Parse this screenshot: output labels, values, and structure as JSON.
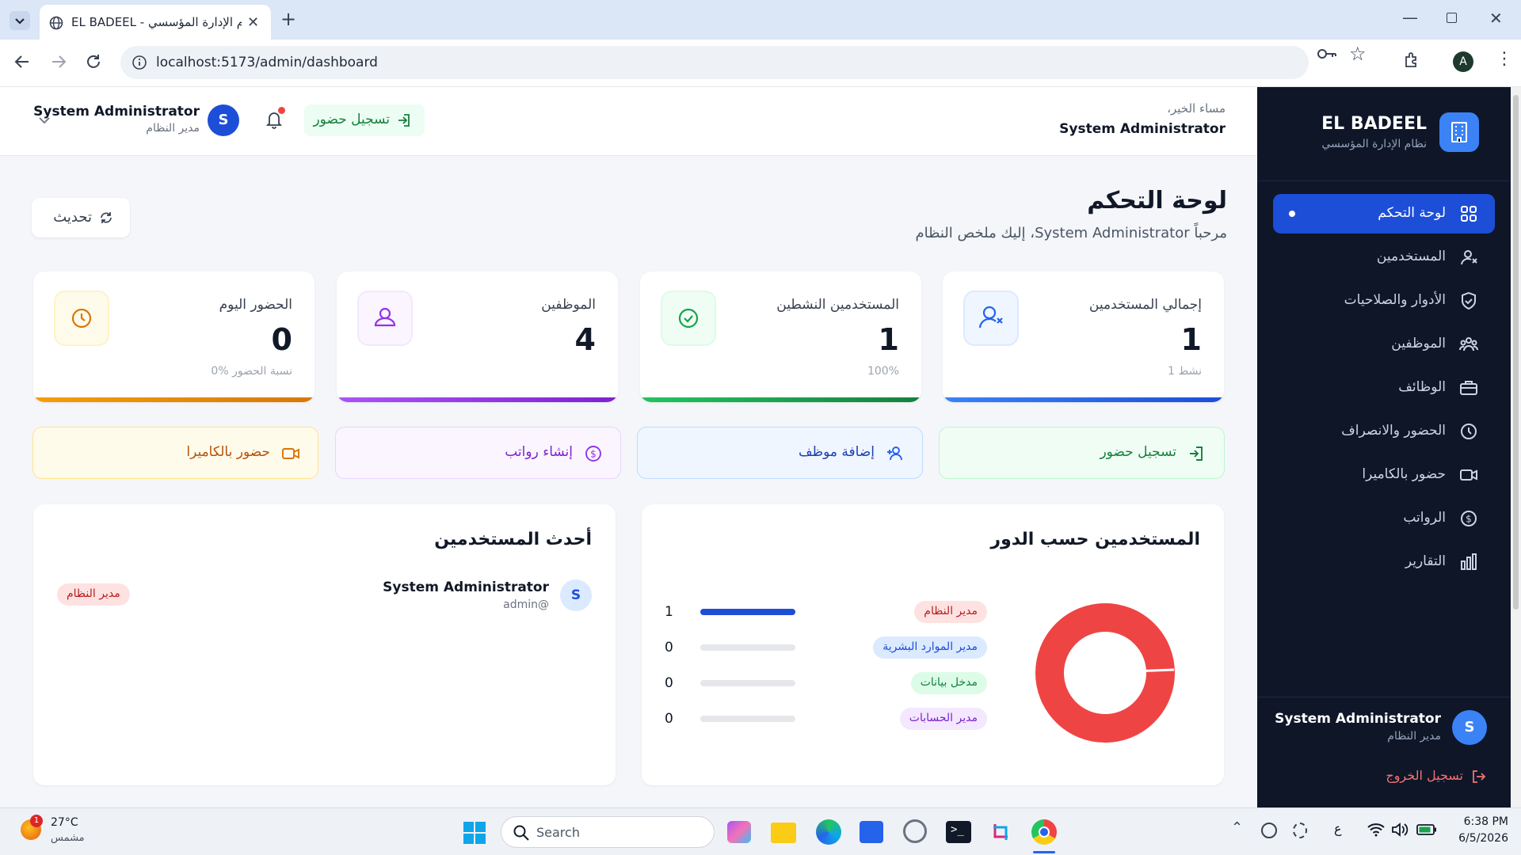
{
  "browser": {
    "tab_title": "EL BADEEL - نظام الإدارة المؤسسي",
    "url": "localhost:5173/admin/dashboard",
    "profile_initial": "A"
  },
  "header": {
    "greeting": "مساء الخير،",
    "user_name": "System Administrator",
    "checkin_label": "تسجيل حضور",
    "profile_name": "System Administrator",
    "profile_role": "مدير النظام",
    "avatar_initial": "S"
  },
  "sidebar": {
    "brand": "EL BADEEL",
    "subtitle": "نظام الإدارة المؤسسي",
    "items": [
      {
        "label": "لوحة التحكم",
        "icon": "grid-icon",
        "active": true
      },
      {
        "label": "المستخدمين",
        "icon": "users-icon"
      },
      {
        "label": "الأدوار والصلاحيات",
        "icon": "shield-icon"
      },
      {
        "label": "الموظفين",
        "icon": "team-icon"
      },
      {
        "label": "الوظائف",
        "icon": "briefcase-icon"
      },
      {
        "label": "الحضور والانصراف",
        "icon": "clock-icon"
      },
      {
        "label": "حضور بالكاميرا",
        "icon": "video-icon"
      },
      {
        "label": "الرواتب",
        "icon": "dollar-icon"
      },
      {
        "label": "التقارير",
        "icon": "bar-chart-icon"
      }
    ],
    "user_name": "System Administrator",
    "user_role": "مدير النظام",
    "user_initial": "S",
    "logout_label": "تسجيل الخروج"
  },
  "page": {
    "title": "لوحة التحكم",
    "subtitle": "مرحباً System Administrator، إليك ملخص النظام",
    "refresh_label": "تحديث"
  },
  "stats": [
    {
      "title": "إجمالي المستخدمين",
      "value": "1",
      "sub": "1 نشط",
      "color": "#3b82f6",
      "icon": "users-icon"
    },
    {
      "title": "المستخدمين النشطين",
      "value": "1",
      "sub": "100%",
      "color": "#22c55e",
      "icon": "check-circle-icon"
    },
    {
      "title": "الموظفين",
      "value": "4",
      "sub": "",
      "color": "#a855f7",
      "icon": "employee-icon"
    },
    {
      "title": "الحضور اليوم",
      "value": "0",
      "sub": "0% نسبة الحضور",
      "color": "#f59e0b",
      "icon": "clock-icon"
    }
  ],
  "actions": [
    {
      "label": "تسجيل حضور",
      "icon": "login-icon",
      "color": "#15803d"
    },
    {
      "label": "إضافة موظف",
      "icon": "user-plus-icon",
      "color": "#1e40af"
    },
    {
      "label": "إنشاء رواتب",
      "icon": "dollar-icon",
      "color": "#7e22ce"
    },
    {
      "label": "حضور بالكاميرا",
      "icon": "video-icon",
      "color": "#b45309"
    }
  ],
  "roles_panel": {
    "title": "المستخدمين حسب الدور",
    "roles": [
      {
        "label": "مدير النظام",
        "count": 1,
        "share": 1.0,
        "bg": "#fee2e2",
        "fg": "#b91c1c"
      },
      {
        "label": "مدير الموارد البشرية",
        "count": 0,
        "share": 0,
        "bg": "#dbeafe",
        "fg": "#1d4ed8"
      },
      {
        "label": "مدخل بيانات",
        "count": 0,
        "share": 0,
        "bg": "#dcfce7",
        "fg": "#15803d"
      },
      {
        "label": "مدير الحسابات",
        "count": 0,
        "share": 0,
        "bg": "#f3e8ff",
        "fg": "#7e22ce"
      }
    ],
    "donut_color": "#ef4444"
  },
  "recent_users": {
    "title": "أحدث المستخدمين",
    "users": [
      {
        "name": "System Administrator",
        "handle": "admin@",
        "initial": "S",
        "role": "مدير النظام"
      }
    ]
  },
  "taskbar": {
    "temperature": "27°C",
    "weather": "مشمس",
    "weather_badge": "1",
    "search": "Search",
    "lang": "ع",
    "time": "6:38 PM",
    "date": "6/5/2026"
  }
}
